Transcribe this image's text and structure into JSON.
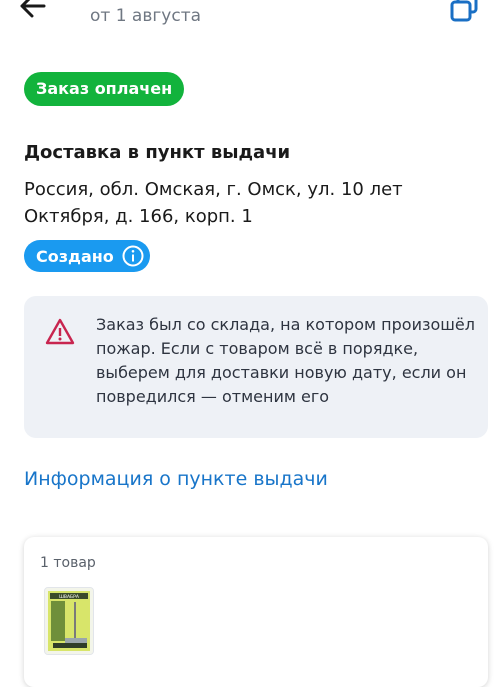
{
  "header": {
    "date": "от 1 августа",
    "back_icon": "arrow-left-icon",
    "copy_icon": "copy-icon"
  },
  "order": {
    "paid_badge": "Заказ оплачен",
    "paid_color": "#12b33c"
  },
  "delivery": {
    "title": "Доставка в пункт выдачи",
    "address": "Россия, обл. Омская, г. Омск, ул. 10 лет Октября, д. 166, корп. 1",
    "status": "Создано",
    "status_color": "#1a9af0",
    "status_icon": "info-icon"
  },
  "warning": {
    "icon": "warning-triangle-icon",
    "icon_color": "#c8254f",
    "text": "Заказ был со склада, на котором произошёл пожар. Если с товаром всё в порядке, выберем для доставки новую дату, если он повредился — отменим его"
  },
  "pickup_info": {
    "link_label": "Информация о пункте выдачи",
    "link_color": "#1875c9"
  },
  "items": {
    "count_label": "1 товар",
    "thumb_label": "ШВАБРА"
  }
}
